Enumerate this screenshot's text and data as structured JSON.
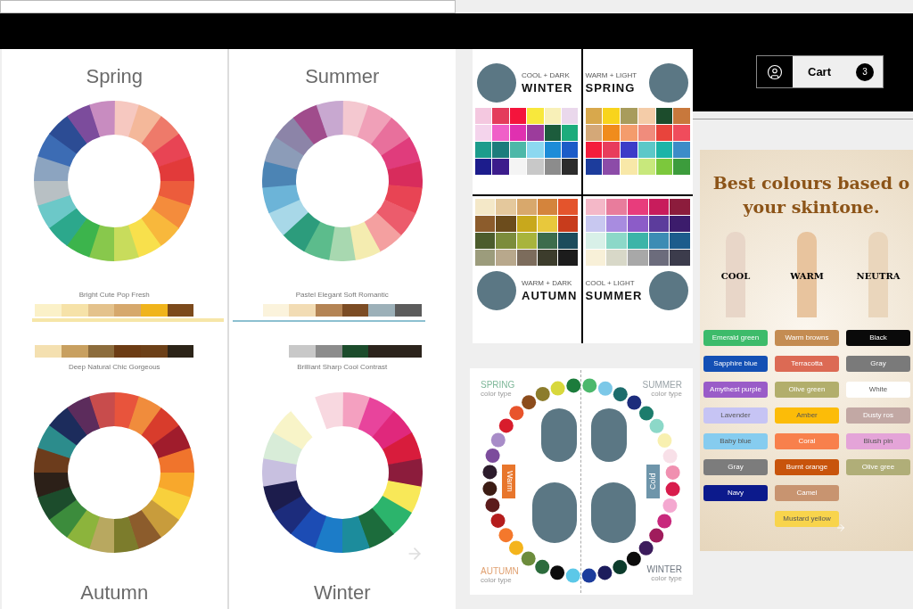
{
  "header": {
    "cart": {
      "label": "Cart",
      "count": "3"
    }
  },
  "wheels_image": {
    "quadrants": [
      {
        "title": "Spring",
        "words": "Bright Cute Pop Fresh",
        "kind": "top"
      },
      {
        "title": "Summer",
        "words": "Pastel Elegant Soft Romantic",
        "kind": "top"
      },
      {
        "title": "Autumn",
        "words": "Deep Natural Chic Gorgeous",
        "kind": "bottom"
      },
      {
        "title": "Winter",
        "words": "Brilliant Sharp Cool Contrast",
        "kind": "bottom"
      }
    ]
  },
  "seasons_image": {
    "quadrants": [
      {
        "subtitle": "COOL + DARK",
        "title": "WINTER",
        "kind": "top"
      },
      {
        "subtitle": "WARM + LIGHT",
        "title": "SPRING",
        "kind": "top"
      },
      {
        "subtitle": "WARM + DARK",
        "title": "AUTUMN",
        "kind": "bottom"
      },
      {
        "subtitle": "COOL + LIGHT",
        "title": "SUMMER",
        "kind": "bottom"
      }
    ]
  },
  "color_type_image": {
    "corners": [
      {
        "title": "SPRING",
        "subtitle": "color type",
        "color": "#7fb89a"
      },
      {
        "title": "SUMMER",
        "subtitle": "color type",
        "color": "#9aa3a8"
      },
      {
        "title": "AUTUMN",
        "subtitle": "color type",
        "color": "#e0a070"
      },
      {
        "title": "WINTER",
        "subtitle": "color type",
        "color": "#6f7780"
      }
    ],
    "tags": [
      {
        "label": "Warm",
        "color": "#e8762c"
      },
      {
        "label": "Cold",
        "color": "#6e95aa"
      }
    ]
  },
  "skintone_image": {
    "title_lines": [
      "Best colours based o",
      "your skintone."
    ],
    "columns": [
      {
        "heading": "COOL",
        "swatches": [
          {
            "label": "Emerald green",
            "color": "#3dbb6a"
          },
          {
            "label": "Sapphire blue",
            "color": "#1450b4"
          },
          {
            "label": "Amythest purple",
            "color": "#9a5cc8"
          },
          {
            "label": "Lavender",
            "color": "#c6c4f4"
          },
          {
            "label": "Baby blue",
            "color": "#86ccef"
          },
          {
            "label": "Gray",
            "color": "#7c7c7c"
          },
          {
            "label": "Navy",
            "color": "#0c1a8c"
          }
        ]
      },
      {
        "heading": "WARM",
        "swatches": [
          {
            "label": "Warm browns",
            "color": "#c48c52"
          },
          {
            "label": "Terracotta",
            "color": "#dc6a54"
          },
          {
            "label": "Olive green",
            "color": "#b2ae6c"
          },
          {
            "label": "Amber",
            "color": "#fcbc08"
          },
          {
            "label": "Coral",
            "color": "#f8804c"
          },
          {
            "label": "Burnt orange",
            "color": "#c8540c"
          },
          {
            "label": "Camel",
            "color": "#c89470"
          },
          {
            "label": "Mustard yellow",
            "color": "#f8d44c"
          }
        ]
      },
      {
        "heading": "NEUTRA",
        "swatches": [
          {
            "label": "Black",
            "color": "#0a0a0a"
          },
          {
            "label": "Gray",
            "color": "#7a7a7a"
          },
          {
            "label": "White",
            "color": "#ffffff"
          },
          {
            "label": "Dusty ros",
            "color": "#c2a8a4"
          },
          {
            "label": "Blush pin",
            "color": "#e4a4d8"
          },
          {
            "label": "Olive gree",
            "color": "#b0ae78"
          }
        ]
      }
    ]
  }
}
